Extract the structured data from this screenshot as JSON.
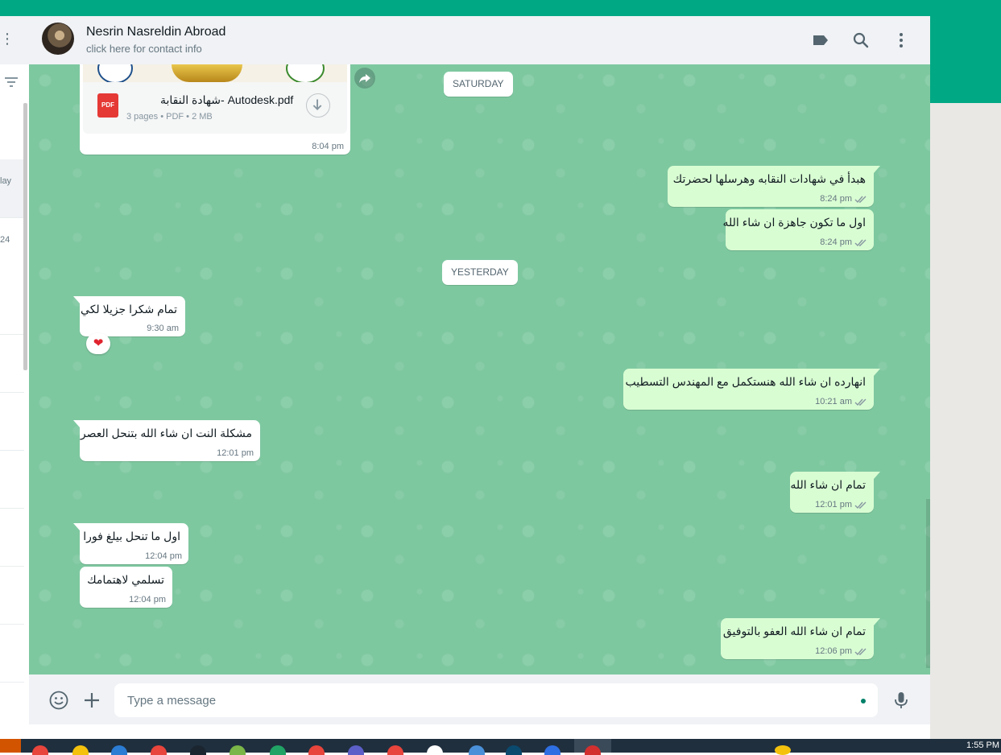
{
  "header": {
    "contact_name": "Nesrin Nasreldin Abroad",
    "contact_subtitle": "click here for contact info",
    "icons": [
      "label-icon",
      "search-icon",
      "menu-icon"
    ]
  },
  "sidebar": {
    "row_texts": [
      "lay",
      "24"
    ]
  },
  "chat": {
    "document": {
      "file_name": "شهادة النقابة- Autodesk.pdf",
      "file_meta": "3 pages • PDF • 2 MB",
      "pdf_badge": "PDF",
      "time": "8:04 pm"
    },
    "day_labels": [
      "SATURDAY",
      "YESTERDAY"
    ],
    "messages": [
      {
        "dir": "out",
        "text": "هبدأ في شهادات النقابه وهرسلها لحضرتك",
        "time": "8:24 pm"
      },
      {
        "dir": "out",
        "text": "اول ما تكون جاهزة ان شاء الله",
        "time": "8:24 pm"
      },
      {
        "dir": "in",
        "text": "تمام شكرا جزيلا لكي",
        "time": "9:30 am",
        "reaction": "❤"
      },
      {
        "dir": "out",
        "text": "انهارده ان شاء الله هنستكمل مع المهندس التسطيب",
        "time": "10:21 am"
      },
      {
        "dir": "in",
        "text": "مشكلة النت ان شاء الله بتنحل العصر",
        "time": "12:01 pm"
      },
      {
        "dir": "out",
        "text": "تمام ان شاء الله",
        "time": "12:01 pm"
      },
      {
        "dir": "in",
        "text": "اول ما تنحل بيلغ فورا",
        "time": "12:04 pm"
      },
      {
        "dir": "in",
        "text": "تسلمي لاهتمامك",
        "time": "12:04 pm"
      },
      {
        "dir": "out",
        "text": "تمام ان شاء الله العفو بالتوفيق",
        "time": "12:06 pm"
      }
    ]
  },
  "composer": {
    "placeholder": "Type a message"
  },
  "taskbar": {
    "clock": "1:55 PM"
  },
  "colors": {
    "brand": "#00a884",
    "chat_background": "#7ec8a0",
    "outgoing_bubble": "#d9fdd3",
    "incoming_bubble": "#ffffff",
    "read_check": "#8696a0"
  }
}
